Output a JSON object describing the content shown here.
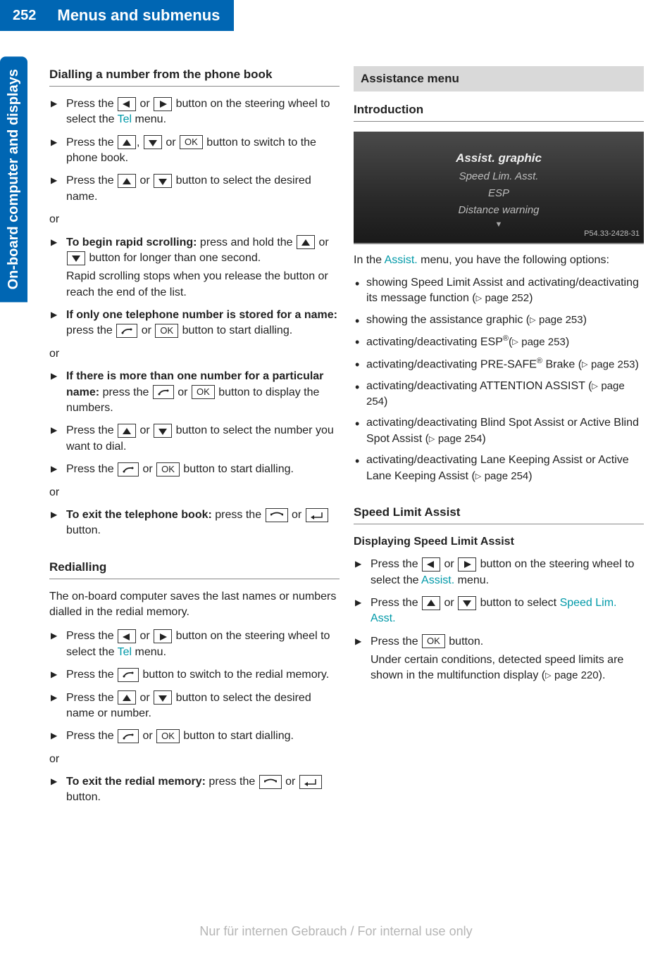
{
  "header": {
    "page_number": "252",
    "chapter_title": "Menus and submenus"
  },
  "side_tab": "On-board computer and displays",
  "left_col": {
    "section1_title": "Dialling a number from the phone book",
    "step_a_1": "Press the ",
    "step_a_2": " or ",
    "step_a_3": " button on the steering wheel to select the ",
    "tel_menu_word": "Tel",
    "step_a_4": " menu.",
    "step_b_1": "Press the ",
    "step_b_2": ", ",
    "step_b_3": " or ",
    "step_b_4": " button to switch to the phone book.",
    "step_c_1": "Press the ",
    "step_c_2": " or ",
    "step_c_3": " button to select the desired name.",
    "or_text": "or",
    "step_d_bold": "To begin rapid scrolling:",
    "step_d_1": " press and hold the ",
    "step_d_2": " or ",
    "step_d_3": " button for longer than one second.",
    "rapid_note": "Rapid scrolling stops when you release the button or reach the end of the list.",
    "step_e_bold": "If only one telephone number is stored for a name:",
    "step_e_1": " press the ",
    "step_e_2": " or ",
    "step_e_3": " button to start dialling.",
    "step_f_bold": "If there is more than one number for a particular name:",
    "step_f_1": " press the ",
    "step_f_2": " or ",
    "step_f_3": " button to display the numbers.",
    "step_g_1": "Press the ",
    "step_g_2": " or ",
    "step_g_3": " button to select the number you want to dial.",
    "step_h_1": "Press the ",
    "step_h_2": " or ",
    "step_h_3": " button to start dialling.",
    "step_i_bold": "To exit the telephone book:",
    "step_i_1": " press the ",
    "step_i_2": " or ",
    "step_i_3": " button.",
    "section2_title": "Redialling",
    "redial_intro": "The on-board computer saves the last names or numbers dialled in the redial memory.",
    "r_step_a_1": "Press the ",
    "r_step_a_2": " or ",
    "r_step_a_3": " button on the steering wheel to select the ",
    "r_step_a_4": " menu.",
    "r_step_b_1": "Press the ",
    "r_step_b_2": " button to switch to the redial memory.",
    "r_step_c_1": "Press the ",
    "r_step_c_2": " or ",
    "r_step_c_3": " button to select the desired name or number.",
    "r_step_d_1": "Press the ",
    "r_step_d_2": " or ",
    "r_step_d_3": " button to start dialling.",
    "r_step_e_bold": "To exit the redial memory:",
    "r_step_e_1": " press the ",
    "r_step_e_2": " or ",
    "r_step_e_3": " button."
  },
  "right_col": {
    "gray_heading": "Assistance menu",
    "intro_title": "Introduction",
    "display": {
      "line1": "Assist. graphic",
      "line2": "Speed Lim. Asst.",
      "line3": "ESP",
      "line4": "Distance warning",
      "code": "P54.33-2428-31"
    },
    "intro_text_1": "In the ",
    "assist_word": "Assist.",
    "intro_text_2": " menu, you have the following options:",
    "bullets": {
      "b1_a": "showing Speed Limit Assist and activating/deactivating its message function (",
      "b1_page": "page 252",
      "b1_c": ")",
      "b2_a": "showing the assistance graphic (",
      "b2_page": "page 253",
      "b2_c": ")",
      "b3_a": "activating/deactivating ESP",
      "b3_b": "(",
      "b3_page": "page 253",
      "b3_c": ")",
      "b4_a": "activating/deactivating PRE-SAFE",
      "b4_b": " Brake (",
      "b4_page": "page 253",
      "b4_c": ")",
      "b5_a": "activating/deactivating ATTENTION ASSIST (",
      "b5_page": "page 254",
      "b5_c": ")",
      "b6_a": "activating/deactivating Blind Spot Assist or Active Blind Spot Assist (",
      "b6_page": "page 254",
      "b6_c": ")",
      "b7_a": "activating/deactivating Lane Keeping Assist or Active Lane Keeping Assist (",
      "b7_page": "page 254",
      "b7_c": ")"
    },
    "sla_title": "Speed Limit Assist",
    "sla_sub": "Displaying Speed Limit Assist",
    "s_step_a_1": "Press the ",
    "s_step_a_2": " or ",
    "s_step_a_3": " button on the steering wheel to select the ",
    "s_step_a_4": " menu.",
    "s_step_b_1": "Press the ",
    "s_step_b_2": " or ",
    "s_step_b_3": " button to select ",
    "sla_menu_item": "Speed Lim. Asst.",
    "s_step_c_1": "Press the ",
    "s_step_c_2": " button.",
    "s_note_a": "Under certain conditions, detected speed limits are shown in the multifunction display (",
    "s_note_page": "page 220",
    "s_note_c": ")."
  },
  "buttons": {
    "ok": "OK"
  },
  "footer": "Nur für internen Gebrauch / For internal use only"
}
